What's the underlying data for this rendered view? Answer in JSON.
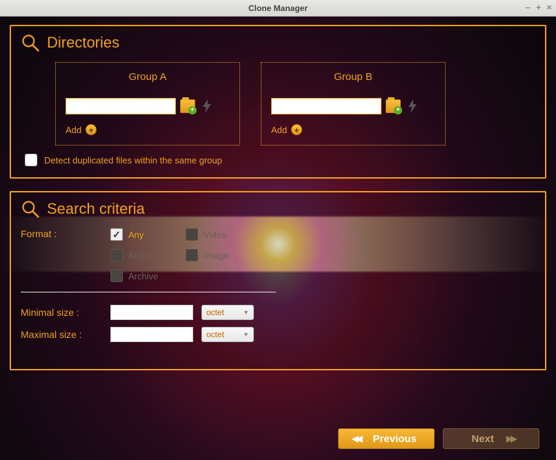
{
  "window": {
    "title": "Clone Manager"
  },
  "directories": {
    "title": "Directories",
    "groups": [
      {
        "name": "Group A",
        "value": "",
        "add_label": "Add"
      },
      {
        "name": "Group B",
        "value": "",
        "add_label": "Add"
      }
    ],
    "detect_label": "Detect duplicated files within the same group",
    "detect_checked": false
  },
  "criteria": {
    "title": "Search criteria",
    "format_label": "Format :",
    "formats": {
      "any": {
        "label": "Any",
        "checked": true,
        "enabled": true
      },
      "audio": {
        "label": "Audio",
        "checked": false,
        "enabled": false
      },
      "archive": {
        "label": "Archive",
        "checked": false,
        "enabled": false
      },
      "video": {
        "label": "Video",
        "checked": false,
        "enabled": false
      },
      "image": {
        "label": "Image",
        "checked": false,
        "enabled": false
      }
    },
    "min_label": "Minimal size :",
    "max_label": "Maximal size :",
    "min_value": "",
    "max_value": "",
    "unit": "octet"
  },
  "footer": {
    "previous": "Previous",
    "next": "Next"
  }
}
